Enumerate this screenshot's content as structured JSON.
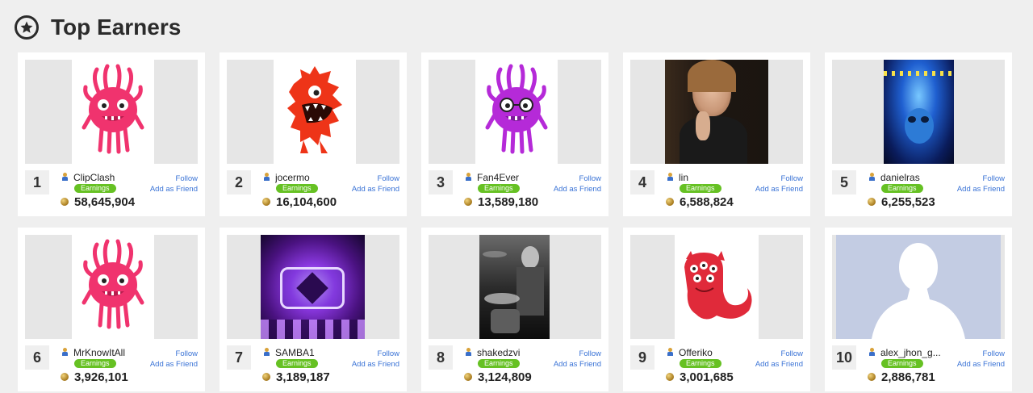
{
  "header": {
    "title": "Top Earners",
    "icon": "star-icon"
  },
  "labels": {
    "badge": "Earnings",
    "follow": "Follow",
    "add_friend": "Add as Friend"
  },
  "colors": {
    "badge_green": "#66c123",
    "link_blue": "#3a73d6"
  },
  "earners": [
    {
      "rank": "1",
      "username": "ClipClash",
      "earnings": "58,645,904",
      "avatar": "pink-monster"
    },
    {
      "rank": "2",
      "username": "jocermo",
      "earnings": "16,104,600",
      "avatar": "red-monster"
    },
    {
      "rank": "3",
      "username": "Fan4Ever",
      "earnings": "13,589,180",
      "avatar": "purple-monster"
    },
    {
      "rank": "4",
      "username": "lin",
      "earnings": "6,588,824",
      "avatar": "woman-photo"
    },
    {
      "rank": "5",
      "username": "danielras",
      "earnings": "6,255,523",
      "avatar": "blue-stage-photo"
    },
    {
      "rank": "6",
      "username": "MrKnowItAll",
      "earnings": "3,926,101",
      "avatar": "pink-monster"
    },
    {
      "rank": "7",
      "username": "SAMBA1",
      "earnings": "3,189,187",
      "avatar": "purple-stage-photo"
    },
    {
      "rank": "8",
      "username": "shakedzvi",
      "earnings": "3,124,809",
      "avatar": "drummer-photo"
    },
    {
      "rank": "9",
      "username": "Offeriko",
      "earnings": "3,001,685",
      "avatar": "ghost-monster"
    },
    {
      "rank": "10",
      "username": "alex_jhon_g...",
      "earnings": "2,886,781",
      "avatar": "default-silhouette"
    }
  ]
}
